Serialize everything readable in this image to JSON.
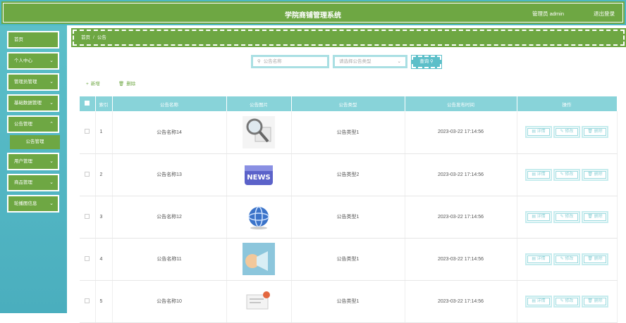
{
  "header": {
    "title": "学院商铺管理系统",
    "user": "管理员 admin",
    "logout": "退出登录"
  },
  "sidebar": {
    "items": [
      {
        "label": "首页",
        "chevron": false
      },
      {
        "label": "个人中心",
        "chevron": true
      },
      {
        "label": "管理员管理",
        "chevron": true
      },
      {
        "label": "基础数据管理",
        "chevron": true
      },
      {
        "label": "公告管理",
        "chevron": true
      },
      {
        "label": "用户管理",
        "chevron": true
      },
      {
        "label": "商品管理",
        "chevron": true
      },
      {
        "label": "轮播图信息",
        "chevron": true
      }
    ],
    "sub_item": "公告管理"
  },
  "breadcrumb": {
    "home": "首页",
    "sep": "/",
    "current": "公告"
  },
  "search": {
    "name_placeholder": "公告名称",
    "type_placeholder": "请选择公告类型",
    "button": "查询"
  },
  "toolbar": {
    "add": "新增",
    "delete": "删除"
  },
  "table": {
    "headers": [
      "索引",
      "公告名称",
      "公告图片",
      "公告类型",
      "公告发布时间",
      "操作"
    ],
    "actions": {
      "detail": "详情",
      "edit": "修改",
      "delete": "删除"
    },
    "rows": [
      {
        "idx": "1",
        "name": "公告名称14",
        "image": "magnifier-newspaper",
        "type": "公告类型1",
        "time": "2023-03-22 17:14:56"
      },
      {
        "idx": "2",
        "name": "公告名称13",
        "image": "news-key",
        "type": "公告类型2",
        "time": "2023-03-22 17:14:56"
      },
      {
        "idx": "3",
        "name": "公告名称12",
        "image": "globe",
        "type": "公告类型1",
        "time": "2023-03-22 17:14:56"
      },
      {
        "idx": "4",
        "name": "公告名称11",
        "image": "speaker-blue",
        "type": "公告类型1",
        "time": "2023-03-22 17:14:56"
      },
      {
        "idx": "5",
        "name": "公告名称10",
        "image": "card-document",
        "type": "公告类型1",
        "time": "2023-03-22 17:14:56"
      }
    ]
  },
  "colors": {
    "green": "#6ea743",
    "teal": "#5cbfc9",
    "header_teal": "#88d3d9"
  }
}
